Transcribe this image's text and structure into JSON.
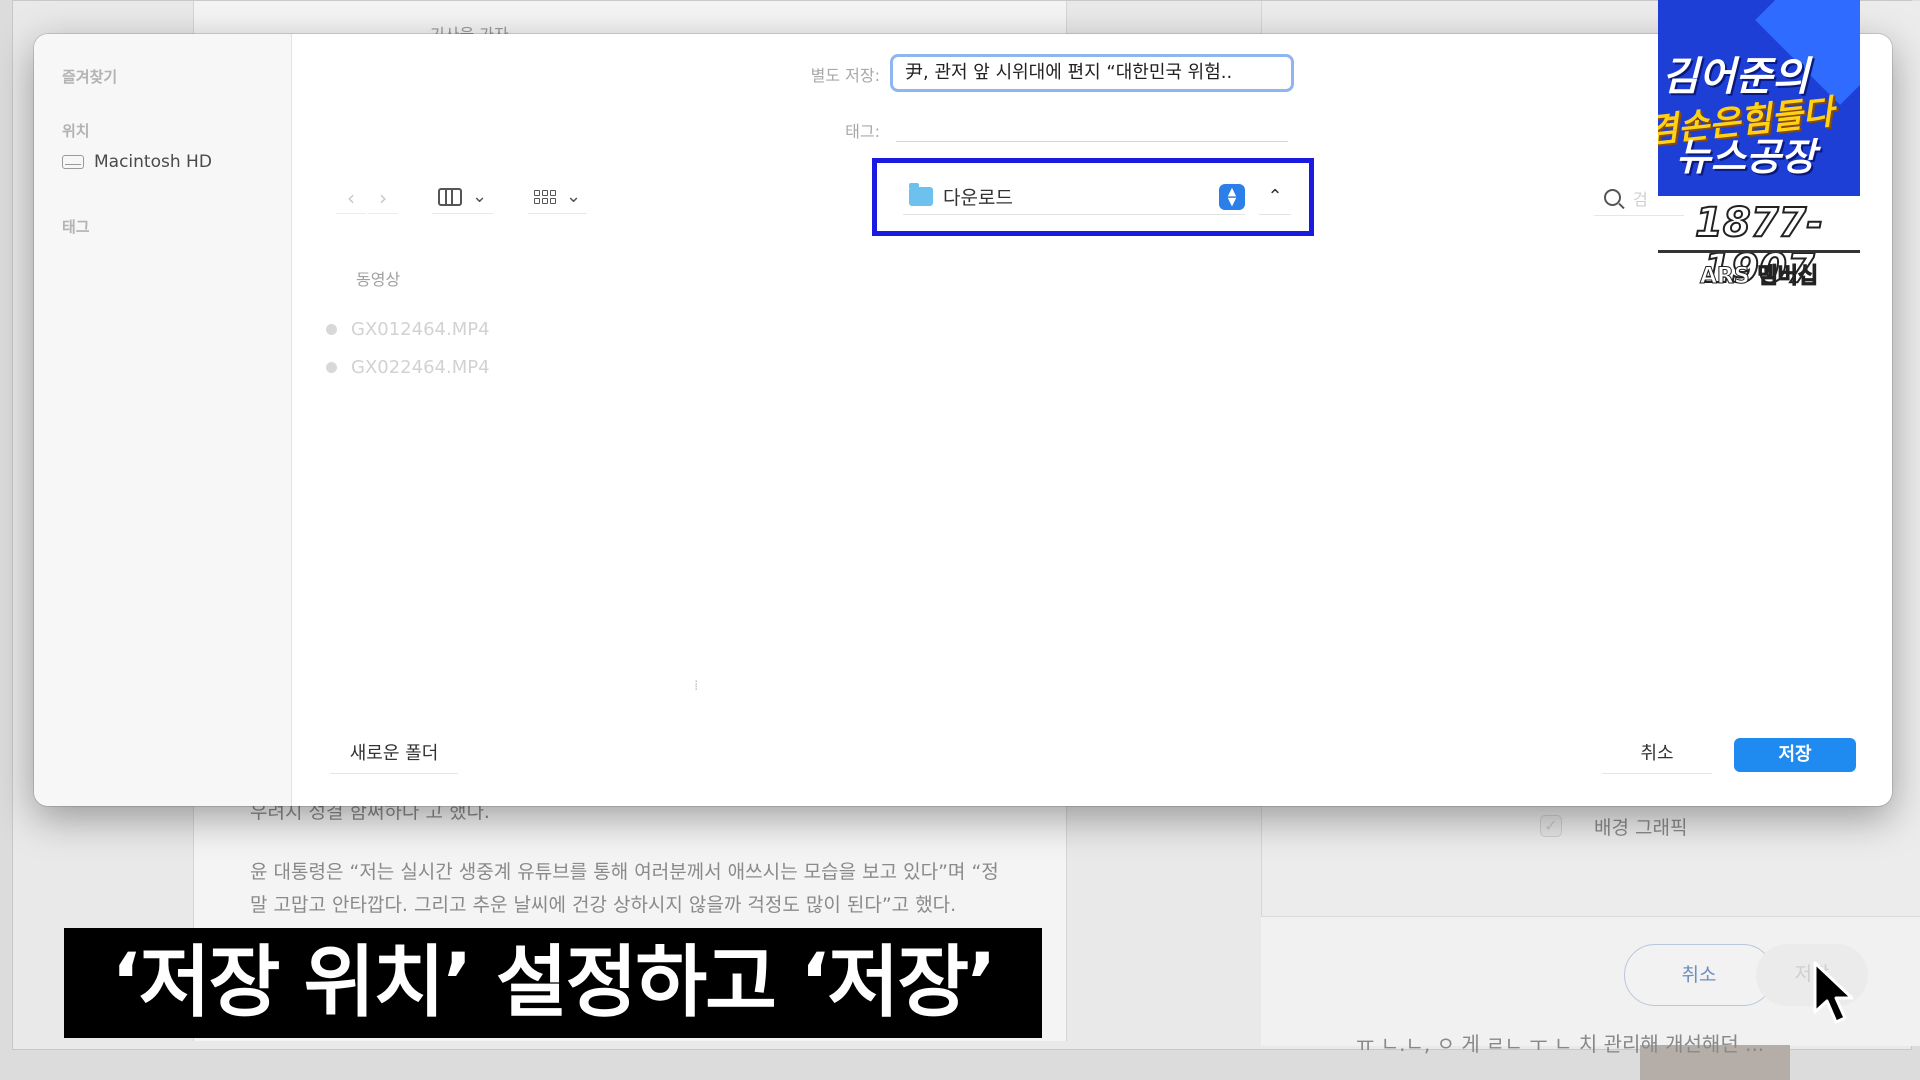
{
  "background": {
    "article_top_text": "기사을 가자",
    "article_lines": [
      "우려지 성결 함써하다 고 했다.",
      "윤 대통령은 “저는 실시간 생중계 유튜브를 통해 여러분께서 애쓰시는 모습을 보고 있다”며 “정",
      "말 고맙고 안타깝다. 그리고 추운 날씨에 건강 상하시지 않을까 걱정도 많이 된다”고 했다."
    ],
    "print_option_label": "배경 그래픽",
    "cancel_label": "취소",
    "save_label": "저장",
    "footer_text": "ㅠ ㄴ.ㄴ, ㅇ 게 ㄹㄴ ㅜ ㄴ 치 관리해 개선해던 ..."
  },
  "dialog": {
    "sidebar": {
      "favorites_heading": "즐겨찾기",
      "locations_heading": "위치",
      "locations": [
        {
          "label": "Macintosh HD",
          "icon": "drive-icon"
        }
      ],
      "tags_heading": "태그"
    },
    "save_as_label": "별도 저장:",
    "save_as_value": "尹, 관저 앞 시위대에 편지 “대한민국 위험..",
    "tags_label": "태그:",
    "nav": {
      "back": "‹",
      "forward": "›"
    },
    "view_column_icon": "columns-icon",
    "view_grid_icon": "grid-icon",
    "chevron": "⌄",
    "location": {
      "name": "다운로드",
      "icon": "folder-icon",
      "highlight_color": "#1a1ae0"
    },
    "expand_glyph": "⌃",
    "search_placeholder": "검",
    "section_heading": "동영상",
    "files": [
      "GX012464.MP4",
      "GX022464.MP4"
    ],
    "splitter_glyph": "⁞",
    "new_folder_label": "새로운 폴더",
    "cancel_label": "취소",
    "save_label": "저장",
    "accent_color": "#1f8bf0"
  },
  "overlay": {
    "logo_line1": "김어준의",
    "logo_line2": "겸손은힘들다",
    "logo_line3": "뉴스공장",
    "phone": "1877-1907",
    "ars_label": "ARS 멤버십",
    "caption": "‘저장 위치’ 설정하고 ‘저장’"
  }
}
